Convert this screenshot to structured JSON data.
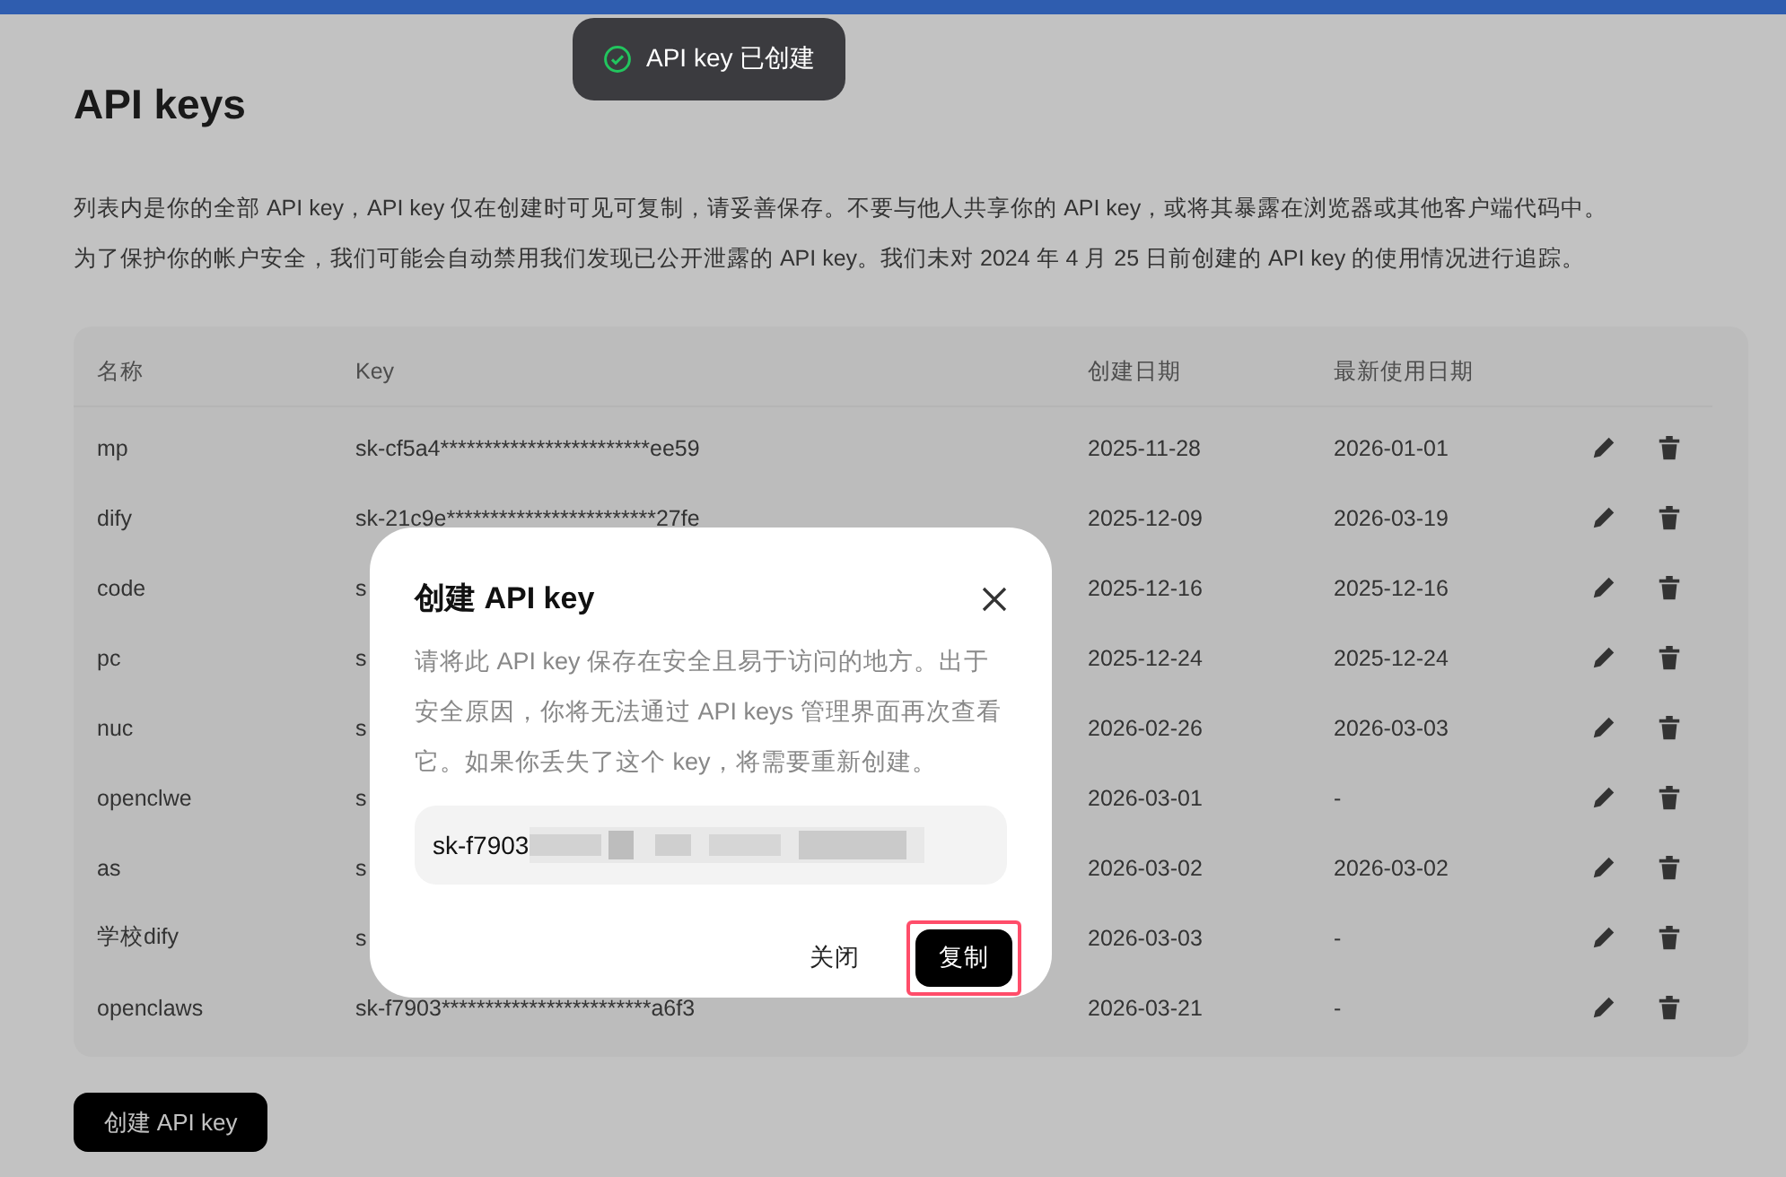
{
  "page": {
    "title": "API keys",
    "description": [
      "列表内是你的全部 API key，API key 仅在创建时可见可复制，请妥善保存。不要与他人共享你的 API key，或将其暴露在浏览器或其他客户端代码中。",
      "为了保护你的帐户安全，我们可能会自动禁用我们发现已公开泄露的 API key。我们未对 2024 年 4 月 25 日前创建的 API key 的使用情况进行追踪。"
    ]
  },
  "table": {
    "columns": [
      "名称",
      "Key",
      "创建日期",
      "最新使用日期"
    ],
    "rows": [
      {
        "name": "mp",
        "key": "sk-cf5a4************************ee59",
        "created": "2025-11-28",
        "last_used": "2026-01-01"
      },
      {
        "name": "dify",
        "key": "sk-21c9e************************27fe",
        "created": "2025-12-09",
        "last_used": "2026-03-19"
      },
      {
        "name": "code",
        "key": "s",
        "created": "2025-12-16",
        "last_used": "2025-12-16"
      },
      {
        "name": "pc",
        "key": "s",
        "created": "2025-12-24",
        "last_used": "2025-12-24"
      },
      {
        "name": "nuc",
        "key": "s",
        "created": "2026-02-26",
        "last_used": "2026-03-03"
      },
      {
        "name": "openclwe",
        "key": "s",
        "created": "2026-03-01",
        "last_used": "-"
      },
      {
        "name": "as",
        "key": "s",
        "created": "2026-03-02",
        "last_used": "2026-03-02"
      },
      {
        "name": "学校dify",
        "key": "s",
        "created": "2026-03-03",
        "last_used": "-"
      },
      {
        "name": "openclaws",
        "key": "sk-f7903************************a6f3",
        "created": "2026-03-21",
        "last_used": "-"
      }
    ]
  },
  "create_button": "创建 API key",
  "toast": {
    "text": "API key 已创建"
  },
  "dialog": {
    "title": "创建 API key",
    "message": "请将此 API key 保存在安全且易于访问的地方。出于安全原因，你将无法通过 API keys 管理界面再次查看它。如果你丢失了这个 key，将需要重新创建。",
    "key_value": "sk-f7903",
    "buttons": [
      {
        "label": "关闭",
        "kind": "secondary",
        "highlighted": false
      },
      {
        "label": "复制",
        "kind": "primary",
        "highlighted": true
      }
    ]
  }
}
